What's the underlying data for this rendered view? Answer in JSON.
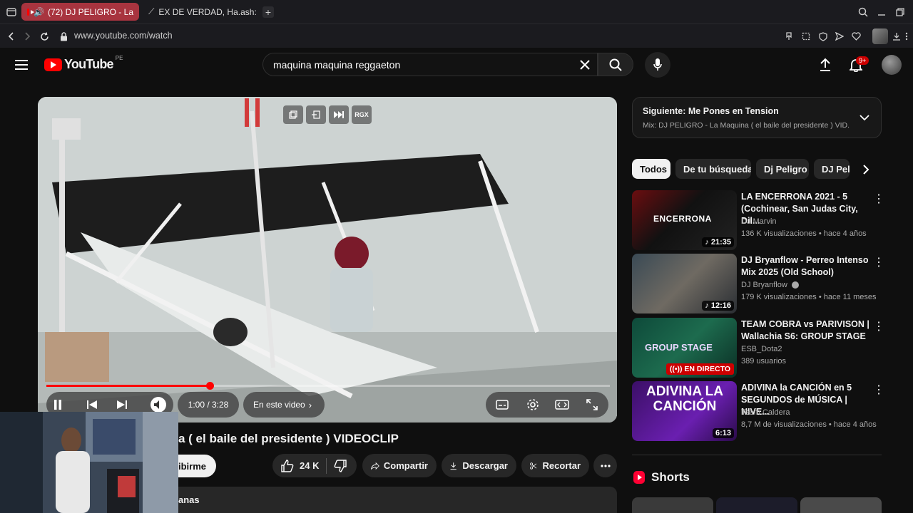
{
  "browser": {
    "tabs": [
      {
        "label": "(72) DJ PELIGRO - La",
        "active": true
      },
      {
        "label": "EX DE VERDAD, Ha.ash: A",
        "active": false
      }
    ],
    "new_tab": "+",
    "url": "www.youtube.com/watch"
  },
  "header": {
    "logo_text": "YouTube",
    "region": "PE",
    "search_value": "maquina maquina reggaeton",
    "notifications_badge": "9+"
  },
  "video": {
    "overlay_buttons": [
      "RGX"
    ],
    "time": "1:00 / 3:28",
    "chapters_label": "En este video",
    "progress_fraction": 0.29,
    "title_visible": "a ( el baile del presidente ) VIDEOCLIP",
    "subscribe_label": "ribirme",
    "description_partial": "anas"
  },
  "actions": {
    "likes": "24 K",
    "share": "Compartir",
    "download": "Descargar",
    "clip": "Recortar"
  },
  "next_up": {
    "label": "Siguiente: Me Pones en Tension",
    "sub": "Mix: DJ PELIGRO - La Maquina ( el baile del presidente ) VID..."
  },
  "chips": [
    "Todos",
    "De tu búsqueda",
    "Dj Peligro",
    "DJ Peli"
  ],
  "recommendations": [
    {
      "title": "LA ENCERRONA 2021 - 5 (Cochinear, San Judas City, Dil...",
      "channel": "DJ Marvin",
      "meta": "136 K visualizaciones • hace 4 años",
      "duration": "21:35",
      "thumb_text": "ENCERRONA"
    },
    {
      "title": "DJ Bryanflow - Perreo Intenso Mix 2025 (Old School)",
      "channel": "DJ Bryanflow",
      "meta": "179 K visualizaciones • hace 11 meses",
      "duration": "12:16",
      "thumb_text": ""
    },
    {
      "title": "TEAM COBRA vs PARIVISON | Wallachia S6: GROUP STAGE",
      "channel": "ESB_Dota2",
      "meta": "389 usuarios",
      "duration": "EN DIRECTO",
      "thumb_text": "GROUP STAGE"
    },
    {
      "title": "ADIVINA la CANCIÓN en 5 SEGUNDOS de MÚSICA | NIVE...",
      "channel": "Team Caldera",
      "meta": "8,7 M de visualizaciones • hace 4 años",
      "duration": "6:13",
      "thumb_text": "ADIVINA LA CANCIÓN"
    }
  ],
  "shorts_label": "Shorts",
  "colors": {
    "accent": "#ff0000",
    "tab_active": "#a8343f",
    "live": "#cc0000"
  }
}
